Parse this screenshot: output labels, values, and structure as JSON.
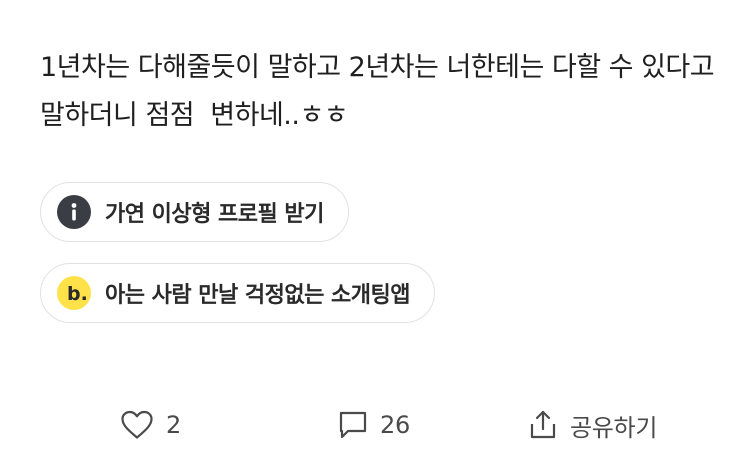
{
  "post": {
    "body": "1년차는 다해줄듯이 말하고 2년차는 너한테는 다할 수 있다고 말하더니 점점  변하네..ㅎㅎ"
  },
  "promos": [
    {
      "label": "가연 이상형 프로필 받기",
      "icon": "info-icon",
      "icon_color": "#3a3d44"
    },
    {
      "label": "아는 사람 만날 걱정없는 소개팅앱",
      "icon": "brand-b-icon",
      "icon_color": "#ffe14a",
      "icon_text": "b."
    }
  ],
  "actions": {
    "like_count": "2",
    "comment_count": "26",
    "share_label": "공유하기"
  }
}
